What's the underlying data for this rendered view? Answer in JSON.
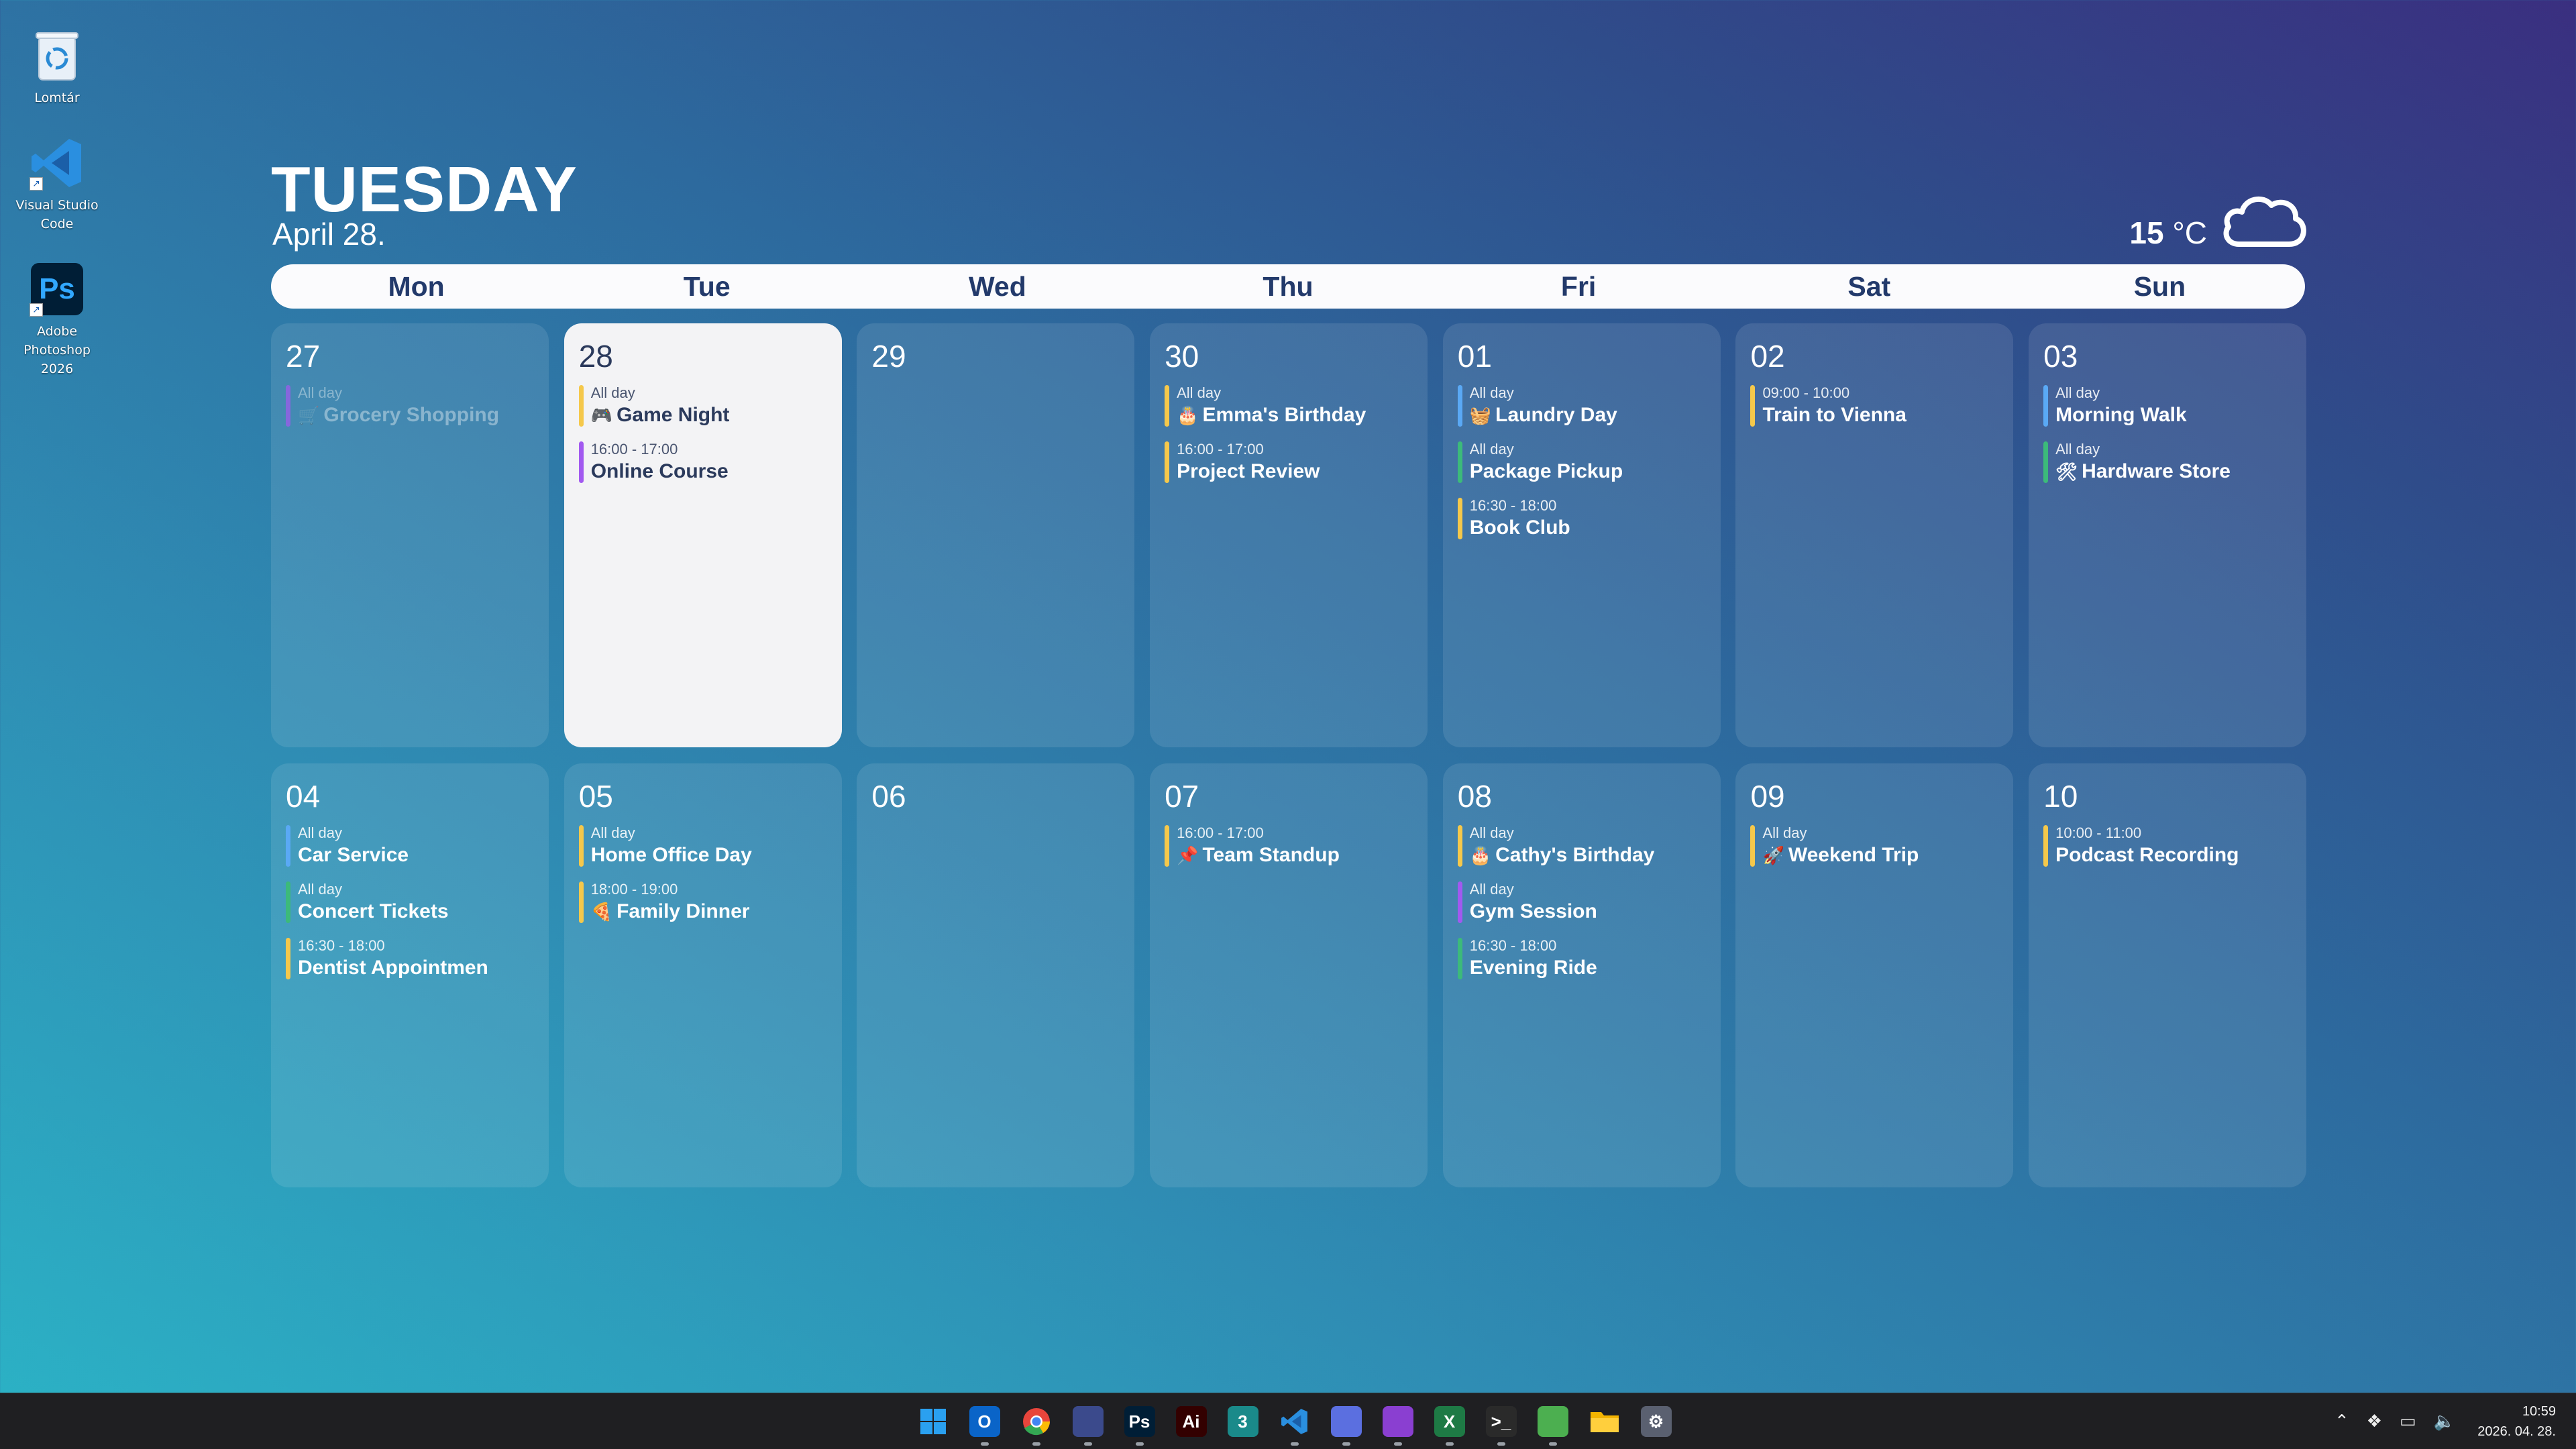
{
  "desktop": {
    "icons": [
      {
        "label": "Lomtár",
        "icon": "recycle-bin-icon"
      },
      {
        "label": "Visual Studio Code",
        "icon": "vscode-icon"
      },
      {
        "label": "Adobe Photoshop 2026",
        "icon": "photoshop-icon"
      }
    ]
  },
  "calendar": {
    "day_name": "TUESDAY",
    "date": "April 28.",
    "weather": {
      "temp": "15",
      "unit": "°C",
      "icon": "cloud-icon"
    },
    "weekdays": [
      "Mon",
      "Tue",
      "Wed",
      "Thu",
      "Fri",
      "Sat",
      "Sun"
    ],
    "days": [
      {
        "num": "27",
        "events": [
          {
            "time": "All day",
            "title": "Grocery Shopping",
            "emoji": "🛒",
            "color": "#a259f0",
            "faded": true
          }
        ]
      },
      {
        "num": "28",
        "today": true,
        "events": [
          {
            "time": "All day",
            "title": "Game Night",
            "emoji": "🎮",
            "color": "#f5c84b"
          },
          {
            "time": "16:00 - 17:00",
            "title": "Online Course",
            "color": "#a259f0"
          }
        ]
      },
      {
        "num": "29",
        "events": []
      },
      {
        "num": "30",
        "events": [
          {
            "time": "All day",
            "title": "Emma's Birthday",
            "emoji": "🎂",
            "color": "#f5c84b"
          },
          {
            "time": "16:00 - 17:00",
            "title": "Project Review",
            "color": "#f5c84b"
          }
        ]
      },
      {
        "num": "01",
        "events": [
          {
            "time": "All day",
            "title": "Laundry Day",
            "emoji": "🧺",
            "color": "#5aa9f5"
          },
          {
            "time": "All day",
            "title": "Package Pickup",
            "color": "#3cba7a"
          },
          {
            "time": "16:30 - 18:00",
            "title": "Book Club",
            "color": "#f5c84b"
          }
        ]
      },
      {
        "num": "02",
        "events": [
          {
            "time": "09:00 - 10:00",
            "title": "Train to Vienna",
            "color": "#f5c84b"
          }
        ]
      },
      {
        "num": "03",
        "events": [
          {
            "time": "All day",
            "title": "Morning Walk",
            "color": "#5aa9f5"
          },
          {
            "time": "All day",
            "title": "Hardware Store",
            "emoji": "🛠",
            "color": "#3cba7a"
          }
        ]
      },
      {
        "num": "04",
        "events": [
          {
            "time": "All day",
            "title": "Car Service",
            "color": "#5aa9f5"
          },
          {
            "time": "All day",
            "title": "Concert Tickets",
            "color": "#3cba7a"
          },
          {
            "time": "16:30 - 18:00",
            "title": "Dentist Appointmen",
            "color": "#f5c84b"
          }
        ]
      },
      {
        "num": "05",
        "events": [
          {
            "time": "All day",
            "title": "Home Office Day",
            "color": "#f5c84b"
          },
          {
            "time": "18:00 - 19:00",
            "title": "Family Dinner",
            "emoji": "🍕",
            "color": "#f5c84b"
          }
        ]
      },
      {
        "num": "06",
        "events": []
      },
      {
        "num": "07",
        "events": [
          {
            "time": "16:00 - 17:00",
            "title": "Team Standup",
            "emoji": "📌",
            "color": "#f5c84b"
          }
        ]
      },
      {
        "num": "08",
        "events": [
          {
            "time": "All day",
            "title": "Cathy's Birthday",
            "emoji": "🎂",
            "color": "#f5c84b"
          },
          {
            "time": "All day",
            "title": "Gym Session",
            "color": "#a259f0"
          },
          {
            "time": "16:30 - 18:00",
            "title": "Evening Ride",
            "color": "#3cba7a"
          }
        ]
      },
      {
        "num": "09",
        "events": [
          {
            "time": "All day",
            "title": "Weekend Trip",
            "emoji": "🚀",
            "color": "#f5c84b"
          }
        ]
      },
      {
        "num": "10",
        "events": [
          {
            "time": "10:00 - 11:00",
            "title": "Podcast Recording",
            "color": "#f5c84b"
          }
        ]
      }
    ]
  },
  "taskbar": {
    "apps": [
      {
        "name": "start-button",
        "glyph": "",
        "color": "#1e90ff",
        "dot": false
      },
      {
        "name": "outlook-app",
        "glyph": "O",
        "color": "#0a64c8",
        "dot": true
      },
      {
        "name": "chrome-app",
        "glyph": "",
        "color": "#e8453c",
        "dot": true
      },
      {
        "name": "save-app",
        "glyph": "",
        "color": "#3b4a8c",
        "dot": true
      },
      {
        "name": "photoshop-app",
        "glyph": "Ps",
        "color": "#001e36",
        "dot": true
      },
      {
        "name": "illustrator-app",
        "glyph": "Ai",
        "color": "#330000",
        "dot": false
      },
      {
        "name": "3dsmax-app",
        "glyph": "3",
        "color": "#1a8a8a",
        "dot": false
      },
      {
        "name": "vscode-app",
        "glyph": "",
        "color": "#1f7fd0",
        "dot": true
      },
      {
        "name": "ai-chat-app",
        "glyph": "",
        "color": "#5b6fe0",
        "dot": true
      },
      {
        "name": "github-app",
        "glyph": "",
        "color": "#8a3fd1",
        "dot": true
      },
      {
        "name": "excel-app",
        "glyph": "X",
        "color": "#1e7a45",
        "dot": true
      },
      {
        "name": "terminal-app",
        "glyph": ">_",
        "color": "#2a2a2a",
        "dot": true
      },
      {
        "name": "notepad-app",
        "glyph": "",
        "color": "#4caf50",
        "dot": true
      },
      {
        "name": "explorer-app",
        "glyph": "",
        "color": "#f4b400",
        "dot": false
      },
      {
        "name": "settings-app",
        "glyph": "⚙",
        "color": "#5a6070",
        "dot": false
      }
    ],
    "clock_time": "10:59",
    "clock_date": "2026. 04. 28."
  }
}
